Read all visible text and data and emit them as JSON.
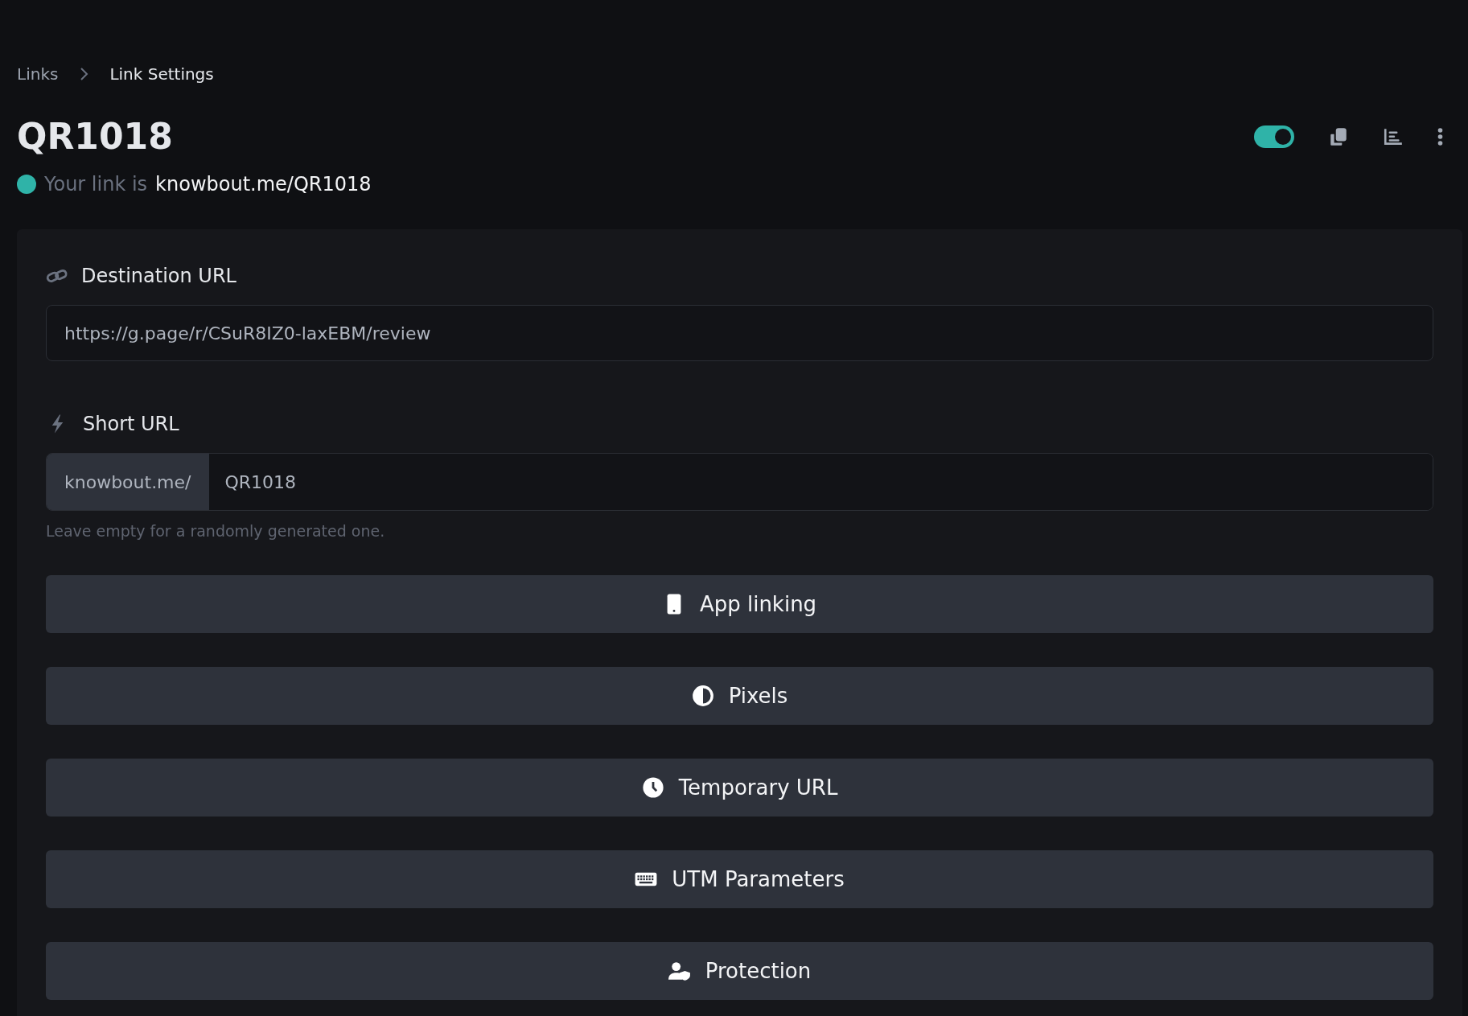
{
  "breadcrumb": [
    {
      "label": "Links"
    },
    {
      "label": "Link Settings"
    }
  ],
  "title": "QR1018",
  "link_status": {
    "prefix": "Your link is",
    "url": "knowbout.me/QR1018"
  },
  "toolbar": {
    "enabled_toggle": {
      "on": true
    }
  },
  "destination": {
    "label": "Destination URL",
    "value": "https://g.page/r/CSuR8IZ0-laxEBM/review"
  },
  "short_url": {
    "label": "Short URL",
    "prefix": "knowbout.me/",
    "value": "QR1018",
    "hint": "Leave empty for a randomly generated one."
  },
  "sections": [
    {
      "kind": "mobile",
      "label": "App linking"
    },
    {
      "kind": "contrast",
      "label": "Pixels"
    },
    {
      "kind": "clock",
      "label": "Temporary URL"
    },
    {
      "kind": "keyboard",
      "label": "UTM Parameters"
    },
    {
      "kind": "user-shield",
      "label": "Protection"
    }
  ]
}
